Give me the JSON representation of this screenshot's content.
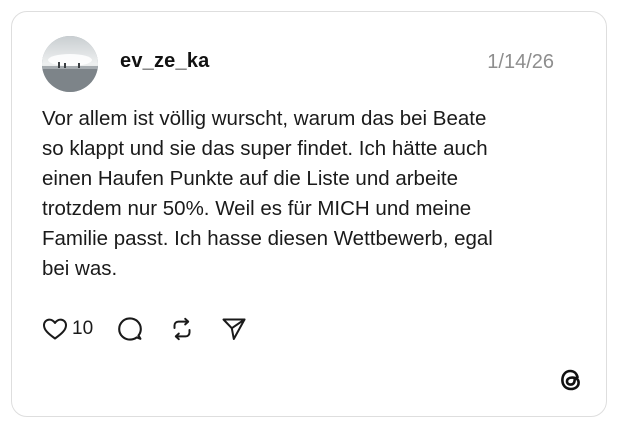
{
  "post": {
    "username": "ev_ze_ka",
    "timestamp": "1/14/26",
    "lines": [
      "Vor allem ist völlig wurscht, warum das bei Beate",
      "so klappt und sie das super findet. Ich hätte auch",
      "einen Haufen Punkte auf die Liste und arbeite",
      "trotzdem nur 50%. Weil es für MICH und meine",
      "Familie passt. Ich hasse diesen Wettbewerb, egal",
      "bei was."
    ],
    "likes": "10"
  },
  "icons": {
    "like": "heart-icon",
    "reply": "speech-bubble-icon",
    "repost": "repost-arrows-icon",
    "share": "paper-plane-icon",
    "brand": "threads-logo-icon"
  },
  "colors": {
    "text": "#1a1a1a",
    "muted": "#8e8e8e",
    "border": "#dedede"
  }
}
